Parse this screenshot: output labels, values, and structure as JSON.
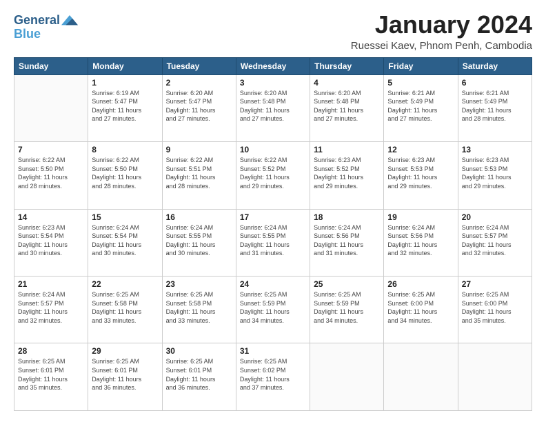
{
  "logo": {
    "line1": "General",
    "line2": "Blue"
  },
  "title": "January 2024",
  "subtitle": "Ruessei Kaev, Phnom Penh, Cambodia",
  "headers": [
    "Sunday",
    "Monday",
    "Tuesday",
    "Wednesday",
    "Thursday",
    "Friday",
    "Saturday"
  ],
  "weeks": [
    [
      {
        "day": "",
        "info": ""
      },
      {
        "day": "1",
        "info": "Sunrise: 6:19 AM\nSunset: 5:47 PM\nDaylight: 11 hours\nand 27 minutes."
      },
      {
        "day": "2",
        "info": "Sunrise: 6:20 AM\nSunset: 5:47 PM\nDaylight: 11 hours\nand 27 minutes."
      },
      {
        "day": "3",
        "info": "Sunrise: 6:20 AM\nSunset: 5:48 PM\nDaylight: 11 hours\nand 27 minutes."
      },
      {
        "day": "4",
        "info": "Sunrise: 6:20 AM\nSunset: 5:48 PM\nDaylight: 11 hours\nand 27 minutes."
      },
      {
        "day": "5",
        "info": "Sunrise: 6:21 AM\nSunset: 5:49 PM\nDaylight: 11 hours\nand 27 minutes."
      },
      {
        "day": "6",
        "info": "Sunrise: 6:21 AM\nSunset: 5:49 PM\nDaylight: 11 hours\nand 28 minutes."
      }
    ],
    [
      {
        "day": "7",
        "info": "Sunrise: 6:22 AM\nSunset: 5:50 PM\nDaylight: 11 hours\nand 28 minutes."
      },
      {
        "day": "8",
        "info": "Sunrise: 6:22 AM\nSunset: 5:50 PM\nDaylight: 11 hours\nand 28 minutes."
      },
      {
        "day": "9",
        "info": "Sunrise: 6:22 AM\nSunset: 5:51 PM\nDaylight: 11 hours\nand 28 minutes."
      },
      {
        "day": "10",
        "info": "Sunrise: 6:22 AM\nSunset: 5:52 PM\nDaylight: 11 hours\nand 29 minutes."
      },
      {
        "day": "11",
        "info": "Sunrise: 6:23 AM\nSunset: 5:52 PM\nDaylight: 11 hours\nand 29 minutes."
      },
      {
        "day": "12",
        "info": "Sunrise: 6:23 AM\nSunset: 5:53 PM\nDaylight: 11 hours\nand 29 minutes."
      },
      {
        "day": "13",
        "info": "Sunrise: 6:23 AM\nSunset: 5:53 PM\nDaylight: 11 hours\nand 29 minutes."
      }
    ],
    [
      {
        "day": "14",
        "info": "Sunrise: 6:23 AM\nSunset: 5:54 PM\nDaylight: 11 hours\nand 30 minutes."
      },
      {
        "day": "15",
        "info": "Sunrise: 6:24 AM\nSunset: 5:54 PM\nDaylight: 11 hours\nand 30 minutes."
      },
      {
        "day": "16",
        "info": "Sunrise: 6:24 AM\nSunset: 5:55 PM\nDaylight: 11 hours\nand 30 minutes."
      },
      {
        "day": "17",
        "info": "Sunrise: 6:24 AM\nSunset: 5:55 PM\nDaylight: 11 hours\nand 31 minutes."
      },
      {
        "day": "18",
        "info": "Sunrise: 6:24 AM\nSunset: 5:56 PM\nDaylight: 11 hours\nand 31 minutes."
      },
      {
        "day": "19",
        "info": "Sunrise: 6:24 AM\nSunset: 5:56 PM\nDaylight: 11 hours\nand 32 minutes."
      },
      {
        "day": "20",
        "info": "Sunrise: 6:24 AM\nSunset: 5:57 PM\nDaylight: 11 hours\nand 32 minutes."
      }
    ],
    [
      {
        "day": "21",
        "info": "Sunrise: 6:24 AM\nSunset: 5:57 PM\nDaylight: 11 hours\nand 32 minutes."
      },
      {
        "day": "22",
        "info": "Sunrise: 6:25 AM\nSunset: 5:58 PM\nDaylight: 11 hours\nand 33 minutes."
      },
      {
        "day": "23",
        "info": "Sunrise: 6:25 AM\nSunset: 5:58 PM\nDaylight: 11 hours\nand 33 minutes."
      },
      {
        "day": "24",
        "info": "Sunrise: 6:25 AM\nSunset: 5:59 PM\nDaylight: 11 hours\nand 34 minutes."
      },
      {
        "day": "25",
        "info": "Sunrise: 6:25 AM\nSunset: 5:59 PM\nDaylight: 11 hours\nand 34 minutes."
      },
      {
        "day": "26",
        "info": "Sunrise: 6:25 AM\nSunset: 6:00 PM\nDaylight: 11 hours\nand 34 minutes."
      },
      {
        "day": "27",
        "info": "Sunrise: 6:25 AM\nSunset: 6:00 PM\nDaylight: 11 hours\nand 35 minutes."
      }
    ],
    [
      {
        "day": "28",
        "info": "Sunrise: 6:25 AM\nSunset: 6:01 PM\nDaylight: 11 hours\nand 35 minutes."
      },
      {
        "day": "29",
        "info": "Sunrise: 6:25 AM\nSunset: 6:01 PM\nDaylight: 11 hours\nand 36 minutes."
      },
      {
        "day": "30",
        "info": "Sunrise: 6:25 AM\nSunset: 6:01 PM\nDaylight: 11 hours\nand 36 minutes."
      },
      {
        "day": "31",
        "info": "Sunrise: 6:25 AM\nSunset: 6:02 PM\nDaylight: 11 hours\nand 37 minutes."
      },
      {
        "day": "",
        "info": ""
      },
      {
        "day": "",
        "info": ""
      },
      {
        "day": "",
        "info": ""
      }
    ]
  ]
}
